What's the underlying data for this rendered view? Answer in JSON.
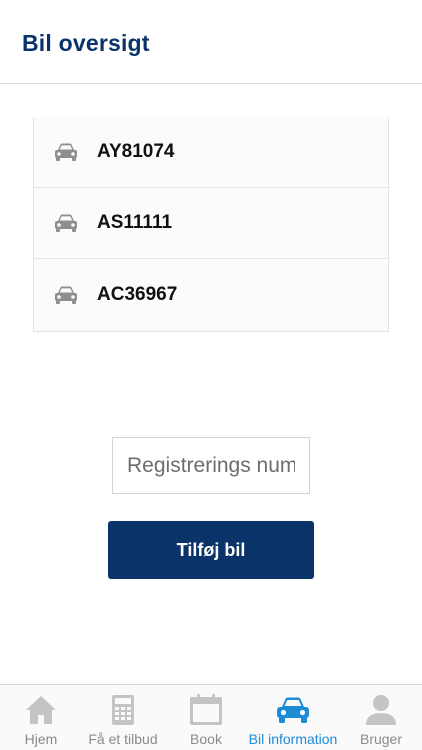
{
  "header": {
    "title": "Bil oversigt"
  },
  "cars": [
    {
      "plate": "AY81074",
      "icon": "car-icon"
    },
    {
      "plate": "AS11111",
      "icon": "car-icon"
    },
    {
      "plate": "AC36967",
      "icon": "car-icon"
    }
  ],
  "form": {
    "registration_placeholder": "Registrerings nummer",
    "registration_value": "",
    "add_button_label": "Tilføj bil"
  },
  "bottom_nav": {
    "active": "Bil information",
    "items": [
      {
        "label": "Hjem",
        "icon": "home-icon"
      },
      {
        "label": "Få et tilbud",
        "icon": "calculator-icon"
      },
      {
        "label": "Book",
        "icon": "calendar-icon"
      },
      {
        "label": "Bil information",
        "icon": "car-icon"
      },
      {
        "label": "Bruger",
        "icon": "user-icon"
      }
    ]
  },
  "colors": {
    "brand": "#0a3369",
    "active_nav": "#1d8bd6",
    "inactive_icon": "#c4c4c4",
    "list_icon": "#8f8f8f"
  }
}
